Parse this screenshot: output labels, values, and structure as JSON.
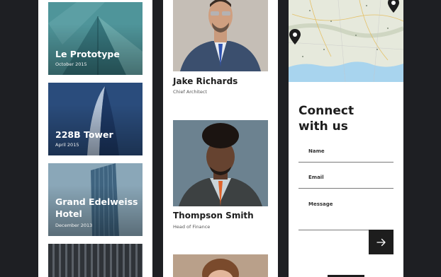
{
  "projects": [
    {
      "title": "Le Prototype",
      "date": "October 2015"
    },
    {
      "title": "228B Tower",
      "date": "April 2015"
    },
    {
      "title_line1": "Grand Edelweiss",
      "title_line2": "Hotel",
      "date": "December 2013"
    },
    {
      "title": "",
      "date": ""
    }
  ],
  "team": [
    {
      "name": "Jake Richards",
      "role": "Chief Architect"
    },
    {
      "name": "Thompson Smith",
      "role": "Head of Finance"
    },
    {
      "name": "",
      "role": ""
    }
  ],
  "contact": {
    "title_line1": "Connect",
    "title_line2": "with us",
    "fields": {
      "name_label": "Name",
      "email_label": "Email",
      "message_label": "Message"
    },
    "send_icon": "arrow-right-icon"
  },
  "map": {
    "pin_icon": "map-pin-icon",
    "water_color": "#a8d4ee",
    "land_color": "#e8eadf"
  },
  "colors": {
    "background": "#1e1f23",
    "panel": "#ffffff",
    "accent_dark": "#1d1d1d"
  }
}
